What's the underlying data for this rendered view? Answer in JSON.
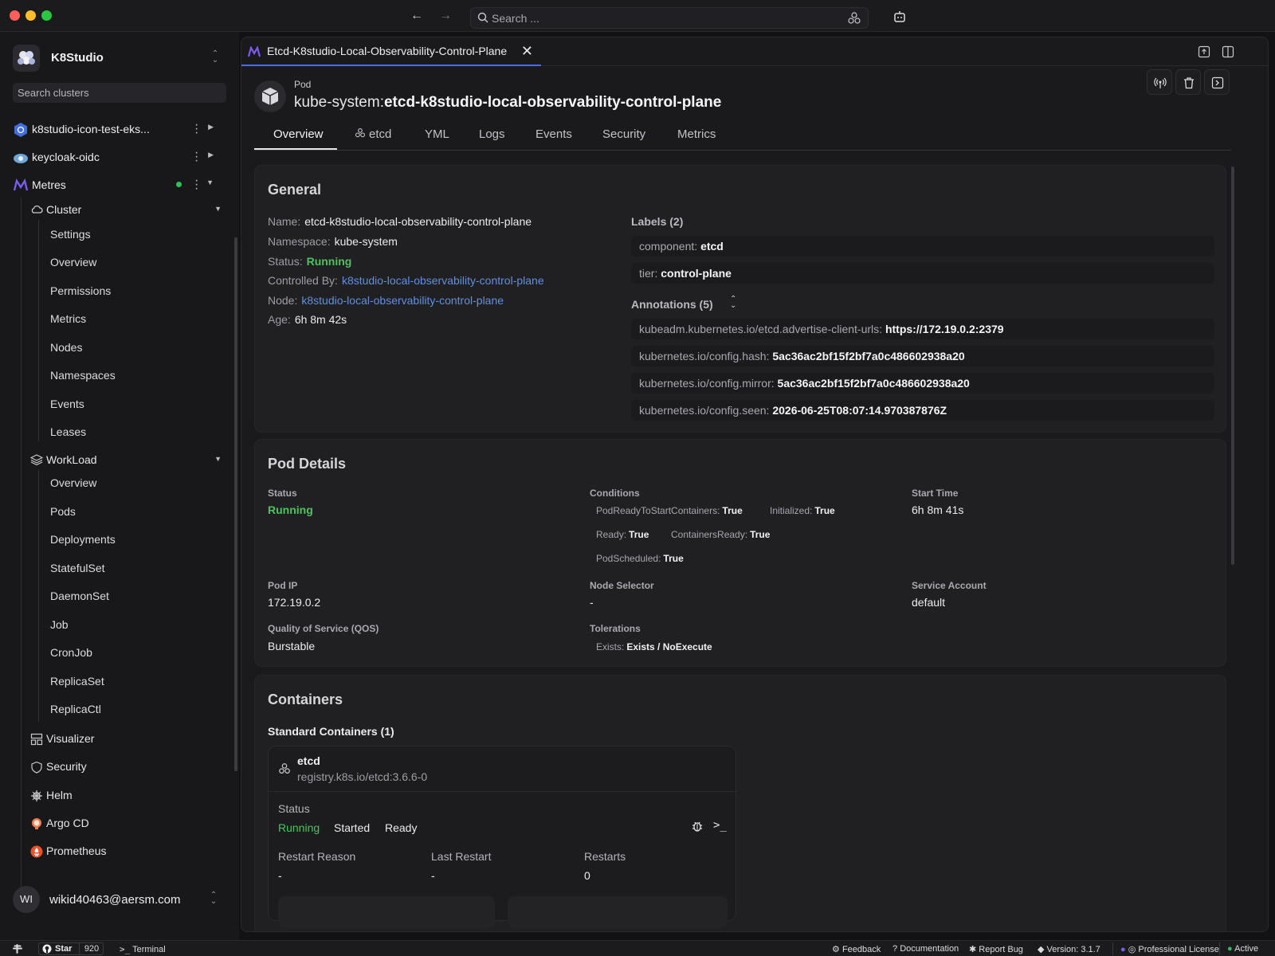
{
  "topbar": {
    "search_placeholder": "Search ..."
  },
  "sidebar": {
    "org_name": "K8Studio",
    "search_placeholder": "Search clusters",
    "clusters": [
      {
        "name": "k8studio-icon-test-eks..."
      },
      {
        "name": "keycloak-oidc"
      },
      {
        "name": "Metres"
      }
    ],
    "cluster_group": {
      "label": "Cluster",
      "items": [
        "Settings",
        "Overview",
        "Permissions",
        "Metrics",
        "Nodes",
        "Namespaces",
        "Events",
        "Leases"
      ]
    },
    "workload_group": {
      "label": "WorkLoad",
      "items": [
        "Overview",
        "Pods",
        "Deployments",
        "StatefulSet",
        "DaemonSet",
        "Job",
        "CronJob",
        "ReplicaSet",
        "ReplicaCtl"
      ]
    },
    "top_items": [
      "Visualizer",
      "Security",
      "Helm",
      "Argo CD",
      "Prometheus"
    ],
    "user": {
      "initials": "WI",
      "email": "wikid40463@aersm.com"
    }
  },
  "tab": {
    "title": "Etcd-K8studio-Local-Observability-Control-Plane"
  },
  "header": {
    "kind": "Pod",
    "namespace_prefix": "kube-system:",
    "name": "etcd-k8studio-local-observability-control-plane"
  },
  "subtabs": [
    "Overview",
    "etcd",
    "YML",
    "Logs",
    "Events",
    "Security",
    "Metrics"
  ],
  "general": {
    "title": "General",
    "name_label": "Name:",
    "name_value": "etcd-k8studio-local-observability-control-plane",
    "namespace_label": "Namespace:",
    "namespace_value": "kube-system",
    "status_label": "Status:",
    "status_value": "Running",
    "controlled_label": "Controlled By:",
    "controlled_value": "k8studio-local-observability-control-plane",
    "node_label": "Node:",
    "node_value": "k8studio-local-observability-control-plane",
    "age_label": "Age:",
    "age_value": "6h 8m 42s",
    "labels_title": "Labels (2)",
    "labels": [
      {
        "key": "component:",
        "value": "etcd"
      },
      {
        "key": "tier:",
        "value": "control-plane"
      }
    ],
    "annotations_title": "Annotations (5)",
    "annotations": [
      {
        "key": "kubeadm.kubernetes.io/etcd.advertise-client-urls:",
        "value": "https://172.19.0.2:2379"
      },
      {
        "key": "kubernetes.io/config.hash:",
        "value": "5ac36ac2bf15f2bf7a0c486602938a20"
      },
      {
        "key": "kubernetes.io/config.mirror:",
        "value": "5ac36ac2bf15f2bf7a0c486602938a20"
      },
      {
        "key": "kubernetes.io/config.seen:",
        "value": "2026-06-25T08:07:14.970387876Z"
      }
    ]
  },
  "pod_details": {
    "title": "Pod Details",
    "status_label": "Status",
    "status_value": "Running",
    "conditions_label": "Conditions",
    "conditions": [
      {
        "key": "PodReadyToStartContainers:",
        "value": "True"
      },
      {
        "key": "Initialized:",
        "value": "True"
      },
      {
        "key": "Ready:",
        "value": "True"
      },
      {
        "key": "ContainersReady:",
        "value": "True"
      },
      {
        "key": "PodScheduled:",
        "value": "True"
      }
    ],
    "start_time_label": "Start Time",
    "start_time_value": "6h 8m 41s",
    "pod_ip_label": "Pod IP",
    "pod_ip_value": "172.19.0.2",
    "node_selector_label": "Node Selector",
    "node_selector_value": "-",
    "service_account_label": "Service Account",
    "service_account_value": "default",
    "qos_label": "Quality of Service (QOS)",
    "qos_value": "Burstable",
    "tolerations_label": "Tolerations",
    "toleration_key": "Exists:",
    "toleration_value": "Exists / NoExecute"
  },
  "containers": {
    "title": "Containers",
    "standard_title": "Standard Containers (1)",
    "container": {
      "name": "etcd",
      "image": "registry.k8s.io/etcd:3.6.6-0",
      "status_label": "Status",
      "states": [
        "Running",
        "Started",
        "Ready"
      ],
      "restart_reason_label": "Restart Reason",
      "restart_reason_value": "-",
      "last_restart_label": "Last Restart",
      "last_restart_value": "-",
      "restarts_label": "Restarts",
      "restarts_value": "0"
    }
  },
  "statusbar": {
    "star_label": "Star",
    "star_count": "920",
    "terminal": "Terminal",
    "feedback": "Feedback",
    "documentation": "Documentation",
    "report_bug": "Report Bug",
    "version": "Version: 3.1.7",
    "license": "Professional License",
    "active": "Active"
  },
  "colors": {
    "accent": "#4b6de8",
    "running_green": "#4cc35e",
    "link_blue": "#5f8fe0",
    "online_dot": "#30c05a"
  }
}
